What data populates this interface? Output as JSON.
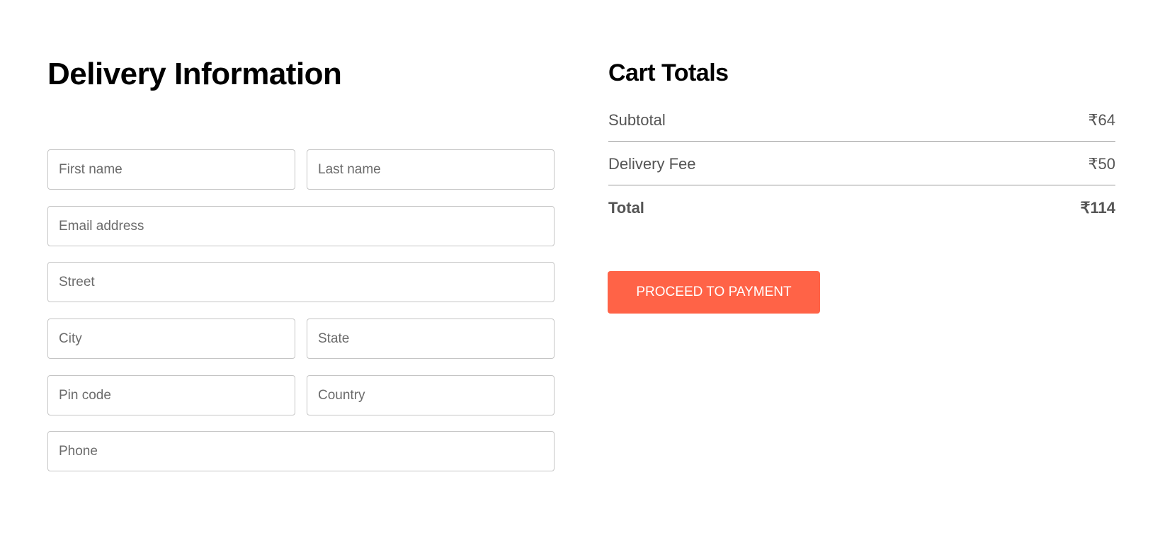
{
  "delivery": {
    "title": "Delivery Information",
    "fields": {
      "first_name": "First name",
      "last_name": "Last name",
      "email": "Email address",
      "street": "Street",
      "city": "City",
      "state": "State",
      "pin": "Pin code",
      "country": "Country",
      "phone": "Phone"
    }
  },
  "cart": {
    "title": "Cart Totals",
    "subtotal_label": "Subtotal",
    "subtotal_value": "₹64",
    "fee_label": "Delivery Fee",
    "fee_value": "₹50",
    "total_label": "Total",
    "total_value": "₹114",
    "button": "PROCEED TO PAYMENT",
    "accent": "#ff6347"
  }
}
